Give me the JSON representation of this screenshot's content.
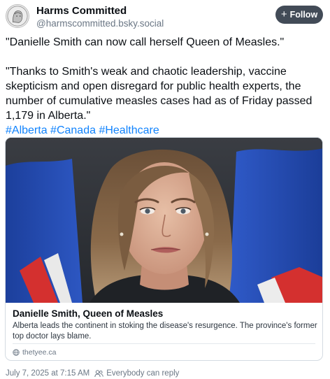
{
  "author": {
    "name": "Harms Committed",
    "handle": "@harmscommitted.bsky.social"
  },
  "follow_button": {
    "label": "Follow",
    "icon": "plus-icon"
  },
  "post": {
    "paragraphs": [
      "\"Danielle Smith can now call herself Queen of Measles.\"",
      "\"Thanks to Smith's weak and chaotic leadership, vaccine skepticism and open disregard for public health experts, the number of cumulative measles cases had as of Friday passed 1,179 in Alberta.\""
    ],
    "hashtags": [
      "#Alberta",
      "#Canada",
      "#Healthcare"
    ]
  },
  "link_card": {
    "title": "Danielle Smith, Queen of Measles",
    "description": "Alberta leads the continent in stoking the disease's resurgence. The province's former top doctor lays blame.",
    "domain": "thetyee.ca",
    "source_icon": "globe-icon"
  },
  "meta": {
    "timestamp": "July 7, 2025 at 7:15 AM",
    "reply_setting": "Everybody can reply",
    "reply_icon": "people-icon"
  },
  "colors": {
    "link": "#1083fe",
    "follow_bg": "#424b57",
    "muted": "#6b7785"
  }
}
